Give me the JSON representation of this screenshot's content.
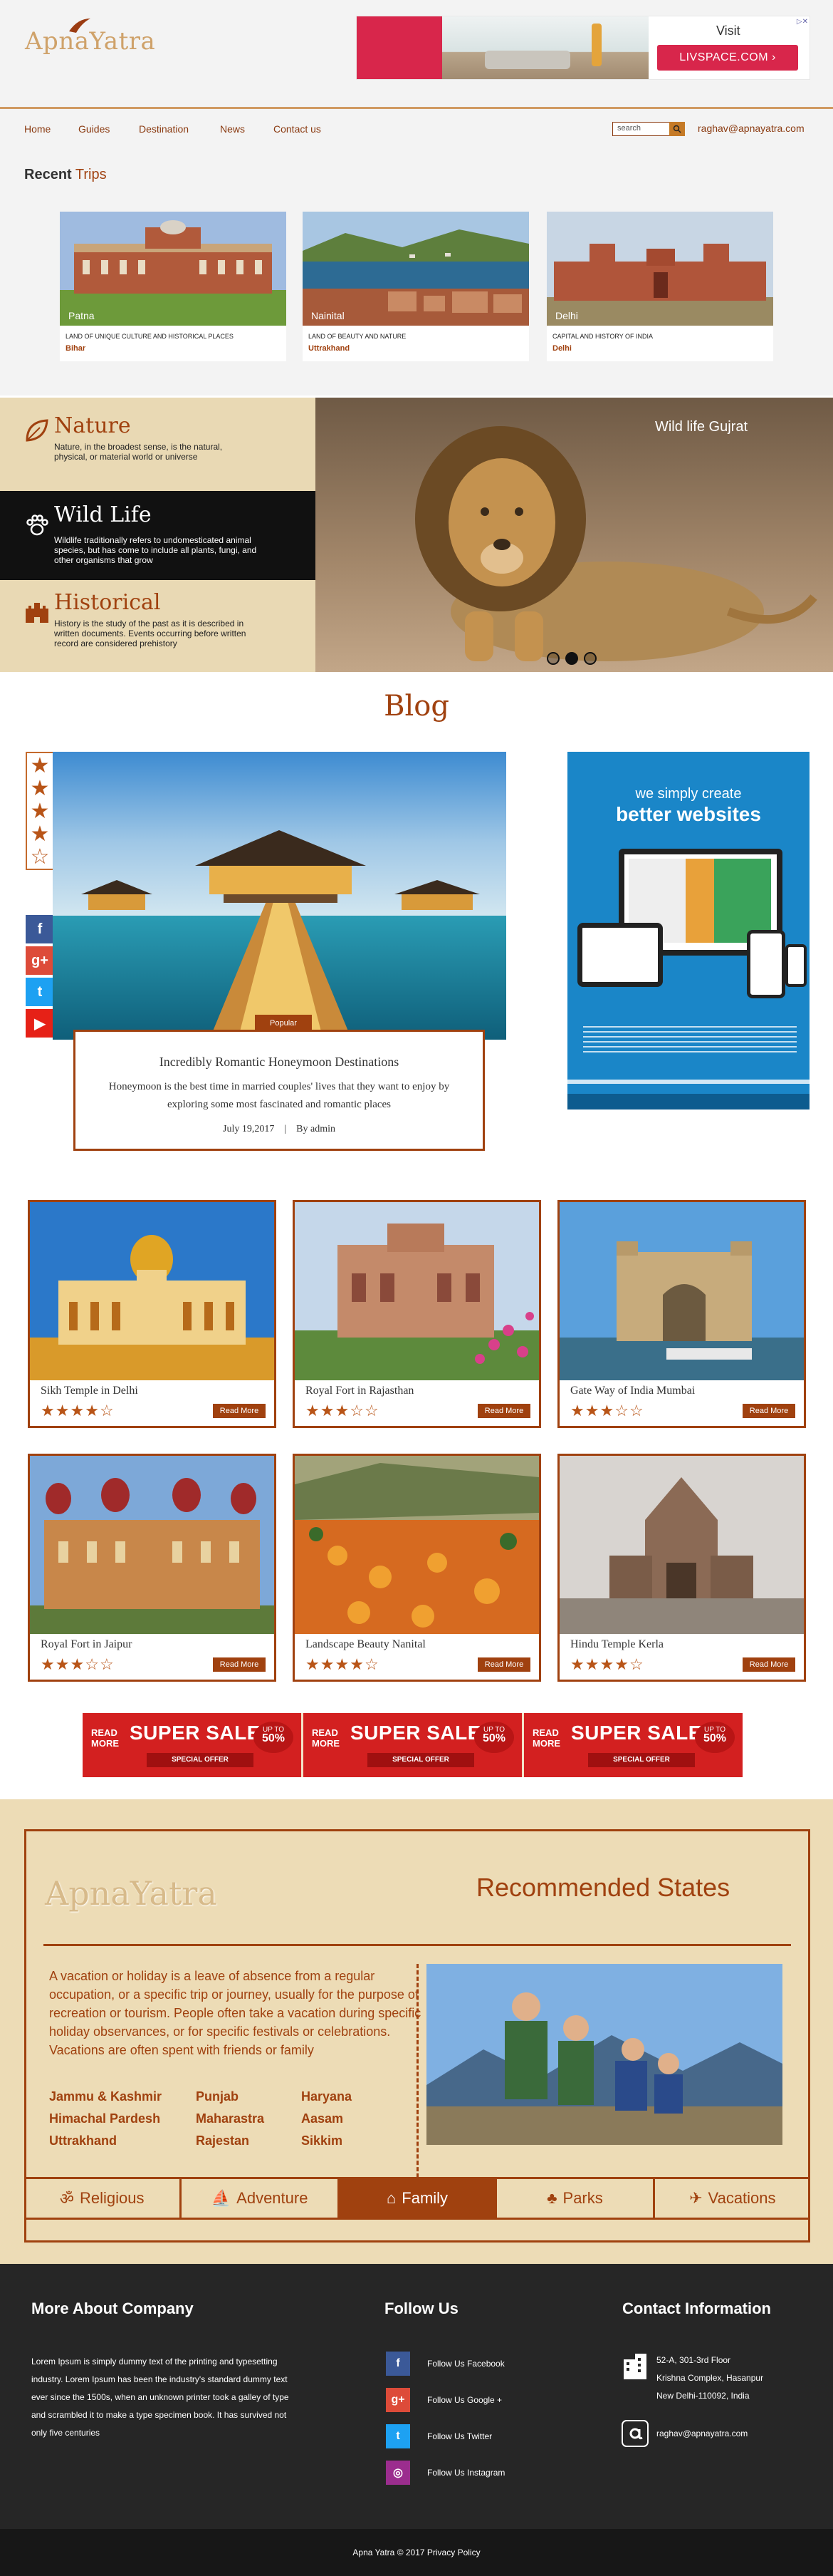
{
  "header": {
    "logo": "ApnaYatra",
    "ad": {
      "visit": "Visit",
      "brand": "LIVSPACE.COM",
      "arrow": "›",
      "close": "▷✕"
    }
  },
  "nav": {
    "items": [
      "Home",
      "Guides",
      "Destination",
      "News",
      "Contact us"
    ],
    "search_placeholder": "search",
    "email": "raghav@apnayatra.com"
  },
  "recent": {
    "title_bold": "Recent",
    "title_rest": " Trips",
    "trips": [
      {
        "place": "Patna",
        "desc": "LAND OF UNIQUE CULTURE AND HISTORICAL PLACES",
        "state": "Bihar"
      },
      {
        "place": "Nainital",
        "desc": "LAND OF BEAUTY AND NATURE",
        "state": "Uttrakhand"
      },
      {
        "place": "Delhi",
        "desc": "CAPITAL AND HISTORY OF INDIA",
        "state": "Delhi"
      }
    ]
  },
  "categories": {
    "items": [
      {
        "title": "Nature",
        "desc": "Nature, in the broadest sense, is the natural, physical, or material world or universe"
      },
      {
        "title": "Wild Life",
        "desc": "Wildlife traditionally refers to undomesticated animal species, but has come to include all plants, fungi, and other organisms that grow"
      },
      {
        "title": "Historical",
        "desc": "History  is the study of the past as it is described in written documents. Events occurring before written record are considered prehistory"
      }
    ],
    "slide_title": "Wild life Gujrat"
  },
  "blog": {
    "title": "Blog",
    "rating": 4,
    "badge": "Popular",
    "post_title": "Incredibly Romantic Honeymoon Destinations",
    "post_text": "Honeymoon is the best time in married couples' lives that they want to enjoy by exploring some most fascinated and romantic places",
    "date": "July 19,2017",
    "sep": "|",
    "author": "By admin",
    "social": [
      "f",
      "g+",
      "t",
      "▶"
    ],
    "side_ad": {
      "line1": "we simply create",
      "line2": "better websites"
    }
  },
  "gallery": {
    "read_more": "Read More",
    "items": [
      {
        "title": "Sikh Temple in Delhi",
        "rating": 4
      },
      {
        "title": "Royal Fort in Rajasthan",
        "rating": 3
      },
      {
        "title": "Gate Way of India Mumbai",
        "rating": 3
      },
      {
        "title": "Royal Fort in Jaipur",
        "rating": 3
      },
      {
        "title": "Landscape Beauty Nanital",
        "rating": 4
      },
      {
        "title": "Hindu Temple Kerla",
        "rating": 4
      }
    ]
  },
  "sale": {
    "read": "READ",
    "more": "MORE",
    "title": "SUPER SALE",
    "upto": "UP TO",
    "pct": "50%",
    "offer": "SPECIAL OFFER"
  },
  "recommended": {
    "logo": "ApnaYatra",
    "title": "Recommended States",
    "text": "A vacation or holiday is a leave of absence from a regular occupation, or a specific trip or journey, usually for the purpose of recreation or tourism. People often take a vacation during specific holiday observances, or for specific festivals or celebrations. Vacations are often spent with friends or family",
    "states": [
      "Jammu & Kashmir",
      "Punjab",
      "Haryana",
      "Himachal Pardesh",
      "Maharastra",
      "Aasam",
      "Uttrakhand",
      "Rajestan",
      "Sikkim"
    ],
    "tabs": [
      {
        "label": "Religious",
        "icon": "ॐ"
      },
      {
        "label": "Adventure",
        "icon": "⛵"
      },
      {
        "label": "Family",
        "icon": "⌂"
      },
      {
        "label": "Parks",
        "icon": "♣"
      },
      {
        "label": "Vacations",
        "icon": "✈"
      }
    ],
    "active_tab": 2
  },
  "footer": {
    "about_title": "More About Company",
    "about_text": "Lorem Ipsum is simply dummy text of the printing and typesetting industry. Lorem Ipsum has been the industry's standard dummy text ever since the 1500s, when an unknown printer took a galley of type and scrambled it to make a type specimen book. It has survived not only five centuries",
    "follow_title": "Follow Us",
    "follow": [
      {
        "label": "Follow Us Facebook",
        "icon": "f"
      },
      {
        "label": "Follow Us Google +",
        "icon": "g+"
      },
      {
        "label": "Follow Us Twitter",
        "icon": "t"
      },
      {
        "label": "Follow Us Instagram",
        "icon": "◎"
      }
    ],
    "contact_title": "Contact Information",
    "address": [
      "52-A, 301-3rd Floor",
      "Krishna Complex, Hasanpur",
      "New Delhi-110092, India"
    ],
    "email": "raghav@apnayatra.com",
    "copyright": "Apna Yatra © 2017 Privacy Policy"
  }
}
